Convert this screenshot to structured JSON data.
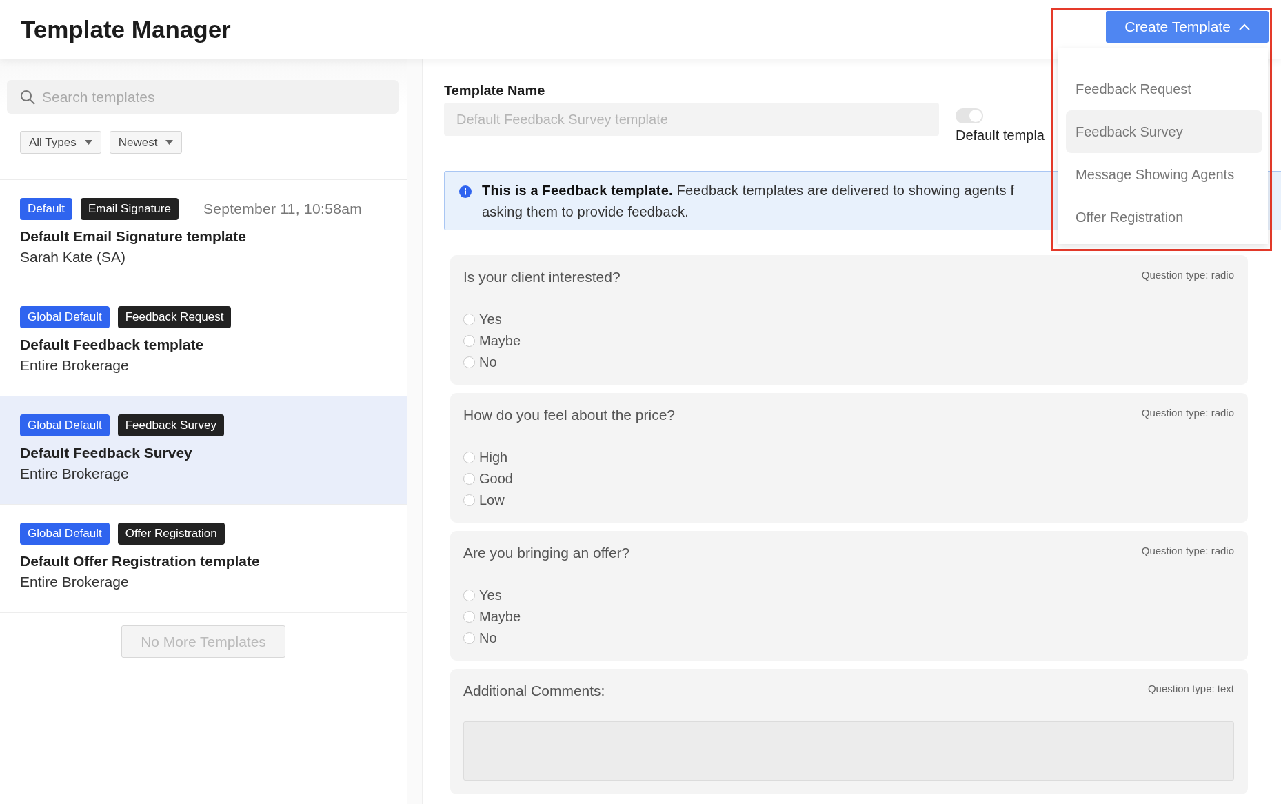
{
  "header": {
    "title": "Template Manager"
  },
  "create_button": {
    "label": "Create Template",
    "expanded": true
  },
  "create_menu": {
    "items": [
      {
        "label": "Feedback Request",
        "selected": false
      },
      {
        "label": "Feedback Survey",
        "selected": true
      },
      {
        "label": "Message Showing Agents",
        "selected": false
      },
      {
        "label": "Offer Registration",
        "selected": false
      }
    ]
  },
  "sidebar": {
    "search": {
      "placeholder": "Search templates"
    },
    "filters": [
      {
        "label": "All Types"
      },
      {
        "label": "Newest"
      }
    ],
    "templates": [
      {
        "badges": [
          {
            "label": "Default",
            "kind": "scope"
          },
          {
            "label": "Email Signature",
            "kind": "type"
          }
        ],
        "date": "September 11, 10:58am",
        "name": "Default Email Signature template",
        "owner": "Sarah Kate (SA)",
        "selected": false
      },
      {
        "badges": [
          {
            "label": "Global Default",
            "kind": "scope"
          },
          {
            "label": "Feedback Request",
            "kind": "type"
          }
        ],
        "name": "Default Feedback template",
        "owner": "Entire Brokerage",
        "selected": false
      },
      {
        "badges": [
          {
            "label": "Global Default",
            "kind": "scope"
          },
          {
            "label": "Feedback Survey",
            "kind": "type"
          }
        ],
        "name": "Default Feedback Survey",
        "owner": "Entire Brokerage",
        "selected": true
      },
      {
        "badges": [
          {
            "label": "Global Default",
            "kind": "scope"
          },
          {
            "label": "Offer Registration",
            "kind": "type"
          }
        ],
        "name": "Default Offer Registration template",
        "owner": "Entire Brokerage",
        "selected": false
      }
    ],
    "end_button": {
      "label": "No More Templates",
      "disabled": true
    }
  },
  "editor": {
    "name_label": "Template Name",
    "name_field": {
      "value": "Default Feedback Survey template",
      "disabled": true
    },
    "default_toggle": {
      "label": "Default templa",
      "on": true,
      "disabled": true
    },
    "info": {
      "lines": [
        "**This is a Feedback template.** Feedback templates are delivered to showing agents f",
        "asking them to provide feedback."
      ]
    },
    "questions": [
      {
        "kind": "radio",
        "text": "Is your client interested?",
        "type_label": "Question type: radio",
        "options": [
          {
            "label": "Yes",
            "selected": false
          },
          {
            "label": "Maybe",
            "selected": false
          },
          {
            "label": "No",
            "selected": false
          }
        ]
      },
      {
        "kind": "radio",
        "text": "How do you feel about the price?",
        "type_label": "Question type: radio",
        "options": [
          {
            "label": "High",
            "selected": false
          },
          {
            "label": "Good",
            "selected": false
          },
          {
            "label": "Low",
            "selected": false
          }
        ]
      },
      {
        "kind": "radio",
        "text": "Are you bringing an offer?",
        "type_label": "Question type: radio",
        "options": [
          {
            "label": "Yes",
            "selected": false
          },
          {
            "label": "Maybe",
            "selected": false
          },
          {
            "label": "No",
            "selected": false
          }
        ]
      },
      {
        "kind": "text",
        "text": "Additional Comments:",
        "type_label": "Question type: text"
      }
    ]
  }
}
